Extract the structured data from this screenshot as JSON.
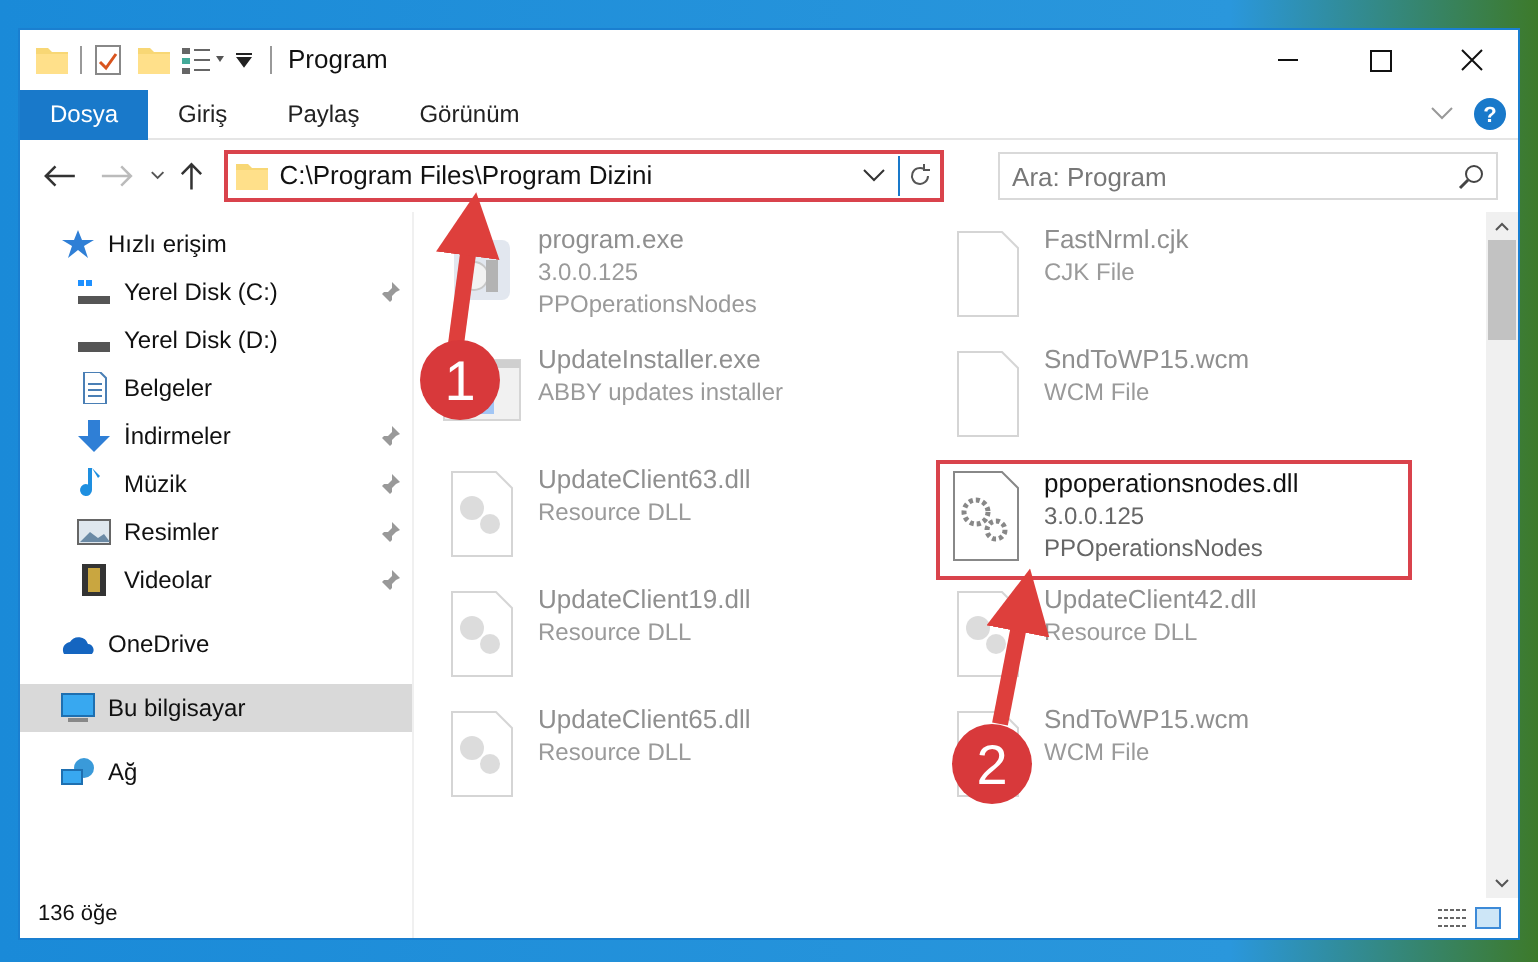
{
  "window": {
    "title": "Program"
  },
  "ribbon_tabs": [
    {
      "label": "Dosya",
      "selected": true
    },
    {
      "label": "Giriş",
      "selected": false
    },
    {
      "label": "Paylaş",
      "selected": false
    },
    {
      "label": "Görünüm",
      "selected": false
    }
  ],
  "address_bar": {
    "path": "C:\\Program Files\\Program Dizini"
  },
  "search": {
    "placeholder": "Ara: Program"
  },
  "help": {
    "label": "?"
  },
  "sidebar": {
    "items": [
      {
        "label": "Hızlı erişim",
        "kind": "star",
        "pinned": false,
        "selected": false,
        "indent": false
      },
      {
        "label": "Yerel Disk (C:)",
        "kind": "drive-c",
        "pinned": true,
        "selected": false,
        "indent": true
      },
      {
        "label": "Yerel Disk (D:)",
        "kind": "drive",
        "pinned": false,
        "selected": false,
        "indent": true
      },
      {
        "label": "Belgeler",
        "kind": "docs",
        "pinned": false,
        "selected": false,
        "indent": true
      },
      {
        "label": "İndirmeler",
        "kind": "download",
        "pinned": true,
        "selected": false,
        "indent": true
      },
      {
        "label": "Müzik",
        "kind": "music",
        "pinned": true,
        "selected": false,
        "indent": true
      },
      {
        "label": "Resimler",
        "kind": "pictures",
        "pinned": true,
        "selected": false,
        "indent": true
      },
      {
        "label": "Videolar",
        "kind": "video",
        "pinned": true,
        "selected": false,
        "indent": true
      },
      {
        "label": "OneDrive",
        "kind": "cloud",
        "pinned": false,
        "selected": false,
        "indent": false
      },
      {
        "label": "Bu bilgisayar",
        "kind": "pc",
        "pinned": false,
        "selected": true,
        "indent": false
      },
      {
        "label": "Ağ",
        "kind": "network",
        "pinned": false,
        "selected": false,
        "indent": false
      }
    ]
  },
  "files": [
    {
      "name": "program.exe",
      "details": [
        "3.0.0.125",
        "PPOperationsNodes"
      ],
      "kind": "app",
      "faded": true
    },
    {
      "name": "FastNrml.cjk",
      "details": [
        "CJK File"
      ],
      "kind": "file",
      "faded": true
    },
    {
      "name": "UpdateInstaller.exe",
      "details": [
        "ABBY updates installer"
      ],
      "kind": "installer",
      "faded": true
    },
    {
      "name": "SndToWP15.wcm",
      "details": [
        "WCM File"
      ],
      "kind": "file",
      "faded": true
    },
    {
      "name": "UpdateClient63.dll",
      "details": [
        "Resource DLL"
      ],
      "kind": "dll",
      "faded": true
    },
    {
      "name": "ppoperationsnodes.dll",
      "details": [
        "3.0.0.125",
        "PPOperationsNodes"
      ],
      "kind": "gear",
      "faded": false
    },
    {
      "name": "UpdateClient19.dll",
      "details": [
        "Resource DLL"
      ],
      "kind": "dll",
      "faded": true
    },
    {
      "name": "UpdateClient42.dll",
      "details": [
        "Resource DLL"
      ],
      "kind": "dll",
      "faded": true
    },
    {
      "name": "UpdateClient65.dll",
      "details": [
        "Resource DLL"
      ],
      "kind": "dll",
      "faded": true
    },
    {
      "name": "SndToWP15.wcm",
      "details": [
        "WCM File"
      ],
      "kind": "file",
      "faded": true
    }
  ],
  "status_bar": {
    "count": "136 öğe"
  },
  "annotations": [
    {
      "label": "1"
    },
    {
      "label": "2"
    }
  ]
}
